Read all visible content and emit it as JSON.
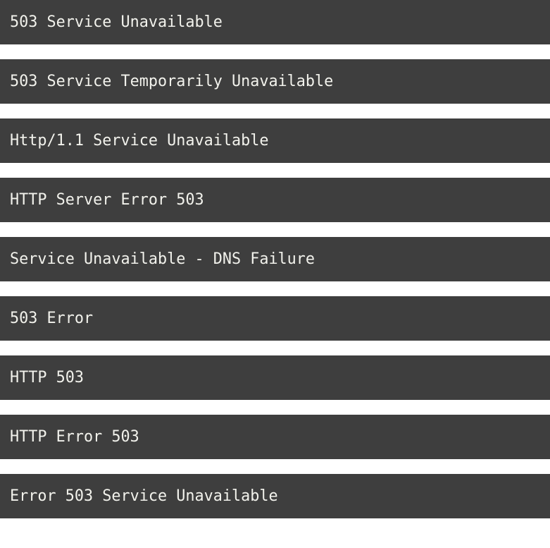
{
  "page": {
    "background_color": "#ffffff",
    "bar_color": "#3e3e3e",
    "text_color": "#f2f2ec"
  },
  "error_list": {
    "items": [
      {
        "label": "503 Service Unavailable"
      },
      {
        "label": "503 Service Temporarily Unavailable"
      },
      {
        "label": "Http/1.1 Service Unavailable"
      },
      {
        "label": "HTTP Server Error 503"
      },
      {
        "label": "Service Unavailable - DNS Failure"
      },
      {
        "label": "503 Error"
      },
      {
        "label": "HTTP 503"
      },
      {
        "label": "HTTP Error 503"
      },
      {
        "label": "Error 503 Service Unavailable"
      }
    ]
  }
}
